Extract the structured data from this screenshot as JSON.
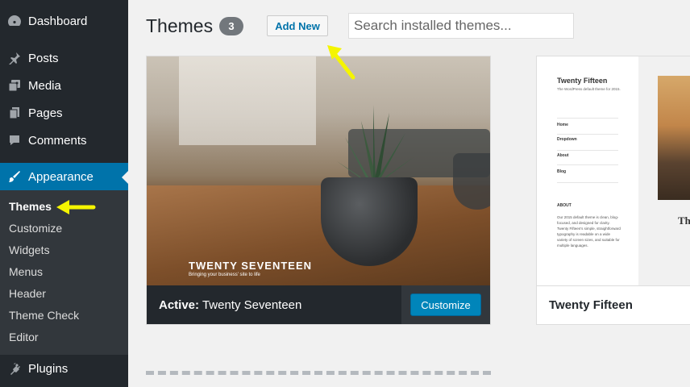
{
  "sidebar": {
    "items": [
      {
        "label": "Dashboard",
        "icon": "dashboard-icon"
      },
      {
        "label": "Posts",
        "icon": "pushpin-icon"
      },
      {
        "label": "Media",
        "icon": "media-icon"
      },
      {
        "label": "Pages",
        "icon": "pages-icon"
      },
      {
        "label": "Comments",
        "icon": "comment-icon"
      },
      {
        "label": "Appearance",
        "icon": "paintbrush-icon"
      },
      {
        "label": "Plugins",
        "icon": "plug-icon"
      }
    ],
    "submenu": [
      "Themes",
      "Customize",
      "Widgets",
      "Menus",
      "Header",
      "Theme Check",
      "Editor"
    ]
  },
  "header": {
    "title": "Themes",
    "count": "3",
    "add_new": "Add New",
    "search_placeholder": "Search installed themes..."
  },
  "themes": [
    {
      "screenshot_title": "TWENTY SEVENTEEN",
      "screenshot_tagline": "Bringing your business' site to life",
      "active_label": "Active:",
      "name": "Twenty Seventeen",
      "action": "Customize"
    },
    {
      "screenshot_title": "Twenty Fifteen",
      "screenshot_desc": "The WordPress default theme for 2015.",
      "screenshot_menu": [
        "Home",
        "Dropdown",
        "About",
        "Blog"
      ],
      "screenshot_about": "ABOUT",
      "screenshot_about_text": "Our 2015 default theme is clean, blog-focused, and designed for clarity. Twenty Fifteen's simple, straightforward typography is readable on a wide variety of screen sizes, and suitable for multiple languages.",
      "screenshot_post_title": "Th",
      "name": "Twenty Fifteen"
    }
  ],
  "colors": {
    "sidebar_bg": "#23282d",
    "accent": "#0073aa",
    "annotation_arrow": "#f5f500"
  }
}
